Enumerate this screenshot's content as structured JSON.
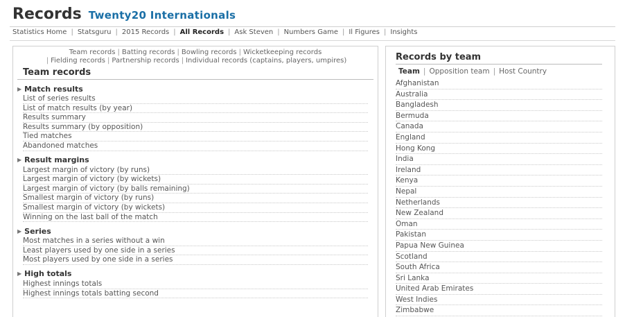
{
  "header": {
    "title": "Records",
    "subtitle": "Twenty20 Internationals"
  },
  "topnav": {
    "items": [
      {
        "label": "Statistics Home"
      },
      {
        "label": "Statsguru"
      },
      {
        "label": "2015 Records"
      },
      {
        "label": "All Records"
      },
      {
        "label": "Ask Steven"
      },
      {
        "label": "Numbers Game"
      },
      {
        "label": "Il Figures"
      },
      {
        "label": "Insights"
      }
    ],
    "active_index": 3
  },
  "subnav": {
    "line1": [
      "Team records",
      "Batting records",
      "Bowling records",
      "Wicketkeeping records"
    ],
    "line2": [
      "Fielding records",
      "Partnership records",
      "Individual records (captains, players, umpires)"
    ]
  },
  "left_panel": {
    "heading": "Team records",
    "sections": [
      {
        "title": "Match results",
        "links": [
          "List of series results",
          "List of match results (by year)",
          "Results summary",
          "Results summary (by opposition)",
          "Tied matches",
          "Abandoned matches"
        ]
      },
      {
        "title": "Result margins",
        "links": [
          "Largest margin of victory (by runs)",
          "Largest margin of victory (by wickets)",
          "Largest margin of victory (by balls remaining)",
          "Smallest margin of victory (by runs)",
          "Smallest margin of victory (by wickets)",
          "Winning on the last ball of the match"
        ]
      },
      {
        "title": "Series",
        "links": [
          "Most matches in a series without a win",
          "Least players used by one side in a series",
          "Most players used by one side in a series"
        ]
      },
      {
        "title": "High totals",
        "links": [
          "Highest innings totals",
          "Highest innings totals batting second"
        ]
      }
    ]
  },
  "right_panel": {
    "title": "Records by team",
    "tabs": [
      "Team",
      "Opposition team",
      "Host Country"
    ],
    "active_tab": 0,
    "teams": [
      "Afghanistan",
      "Australia",
      "Bangladesh",
      "Bermuda",
      "Canada",
      "England",
      "Hong Kong",
      "India",
      "Ireland",
      "Kenya",
      "Nepal",
      "Netherlands",
      "New Zealand",
      "Oman",
      "Pakistan",
      "Papua New Guinea",
      "Scotland",
      "South Africa",
      "Sri Lanka",
      "United Arab Emirates",
      "West Indies",
      "Zimbabwe"
    ]
  },
  "colors": {
    "subtitle": "#1a6fa6",
    "text": "#555555",
    "border": "#cfcfcf"
  },
  "icons": {
    "section_bullet": "triangle-right-icon"
  }
}
